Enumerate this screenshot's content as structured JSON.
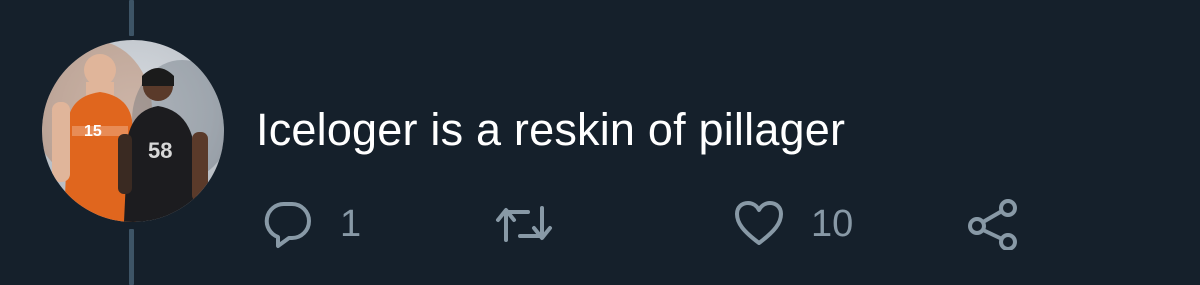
{
  "tweet": {
    "text": "Iceloger is a reskin of pillager",
    "avatar_icon": "user-avatar-icon"
  },
  "actions": {
    "reply": {
      "icon": "reply-icon",
      "count": "1"
    },
    "retweet": {
      "icon": "retweet-icon",
      "count": ""
    },
    "like": {
      "icon": "heart-icon",
      "count": "10"
    },
    "share": {
      "icon": "share-icon"
    }
  },
  "colors": {
    "background": "#15202b",
    "text": "#ffffff",
    "icon": "#8899a6",
    "thread_line": "#3d5466"
  }
}
